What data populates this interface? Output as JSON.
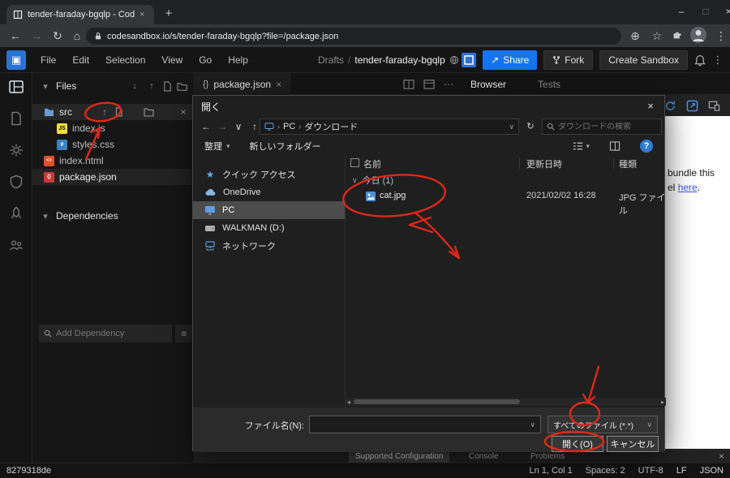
{
  "icons": {
    "back": "←",
    "forward": "→",
    "reload": "↻",
    "home": "⌂",
    "install": "⊕",
    "bookmark": "☆",
    "kebab": "⋮",
    "minimize": "–",
    "maximize": "□",
    "close": "×",
    "plus": "+",
    "up_arrow": "↑",
    "down_arrow": "↓",
    "caret_down": "▾",
    "chevron": "›",
    "chevron_down": "∨",
    "ellipsis": "⋯",
    "menu": "≡",
    "scroll_left": "◂",
    "scroll_right": "▸",
    "share_arrow": "↗",
    "refresh": "↻",
    "star": "★",
    "help": "?"
  },
  "browser": {
    "tab_title": "tender-faraday-bgqlp - CodeSan",
    "url": "codesandbox.io/s/tender-faraday-bgqlp?file=/package.json"
  },
  "menubar": {
    "items": [
      {
        "label": "File"
      },
      {
        "label": "Edit"
      },
      {
        "label": "Selection"
      },
      {
        "label": "View"
      },
      {
        "label": "Go"
      },
      {
        "label": "Help"
      }
    ],
    "breadcrumb": {
      "folder": "Drafts",
      "separator": "/",
      "name": "tender-faraday-bgqlp"
    },
    "share_label": "Share",
    "fork_label": "Fork",
    "create_sandbox_label": "Create Sandbox"
  },
  "files_panel": {
    "header": "Files",
    "src_folder": "src",
    "files": {
      "index_js": "index.js",
      "styles_css": "styles.css",
      "index_html": "index.html",
      "package_json": "package.json"
    },
    "badges": {
      "js": "JS",
      "css": "#",
      "html": "<>",
      "json": "{}"
    },
    "dependencies_header": "Dependencies",
    "add_dependency_placeholder": "Add Dependency"
  },
  "editor": {
    "tab_icon": "{}",
    "tab_label": "package.json"
  },
  "preview": {
    "tabs": [
      {
        "label": "Browser"
      },
      {
        "label": "Tests"
      }
    ],
    "body_line1": "bundle this",
    "body_line2_prefix": "el ",
    "body_link": "here",
    "body_line2_suffix": "."
  },
  "bottom_panel": {
    "tabs": [
      {
        "label": "Supported Configuration"
      },
      {
        "label": "Console"
      },
      {
        "label": "Problems"
      }
    ]
  },
  "dialog": {
    "title": "開く",
    "breadcrumb_pc": "PC",
    "breadcrumb_folder": "ダウンロード",
    "search_placeholder": "ダウンロードの検索",
    "organize_label": "整理",
    "new_folder_label": "新しいフォルダー",
    "nav_items": [
      {
        "label": "クイック アクセス"
      },
      {
        "label": "OneDrive"
      },
      {
        "label": "PC"
      },
      {
        "label": "WALKMAN (D:)"
      },
      {
        "label": "ネットワーク"
      }
    ],
    "columns": {
      "name": "名前",
      "modified": "更新日時",
      "type": "種類"
    },
    "group_label": "今日 (1)",
    "file": {
      "name": "cat.jpg",
      "modified": "2021/02/02 16:28",
      "type": "JPG ファイル"
    },
    "filename_label": "ファイル名(N):",
    "filetype_value": "すべてのファイル (*.*)",
    "open_label": "開く(O)",
    "cancel_label": "キャンセル"
  },
  "statusbar": {
    "commit": "8279318de",
    "items": [
      {
        "label": "Ln 1, Col 1"
      },
      {
        "label": "Spaces: 2"
      },
      {
        "label": "UTF-8"
      },
      {
        "label": "LF"
      },
      {
        "label": "JSON"
      }
    ]
  }
}
